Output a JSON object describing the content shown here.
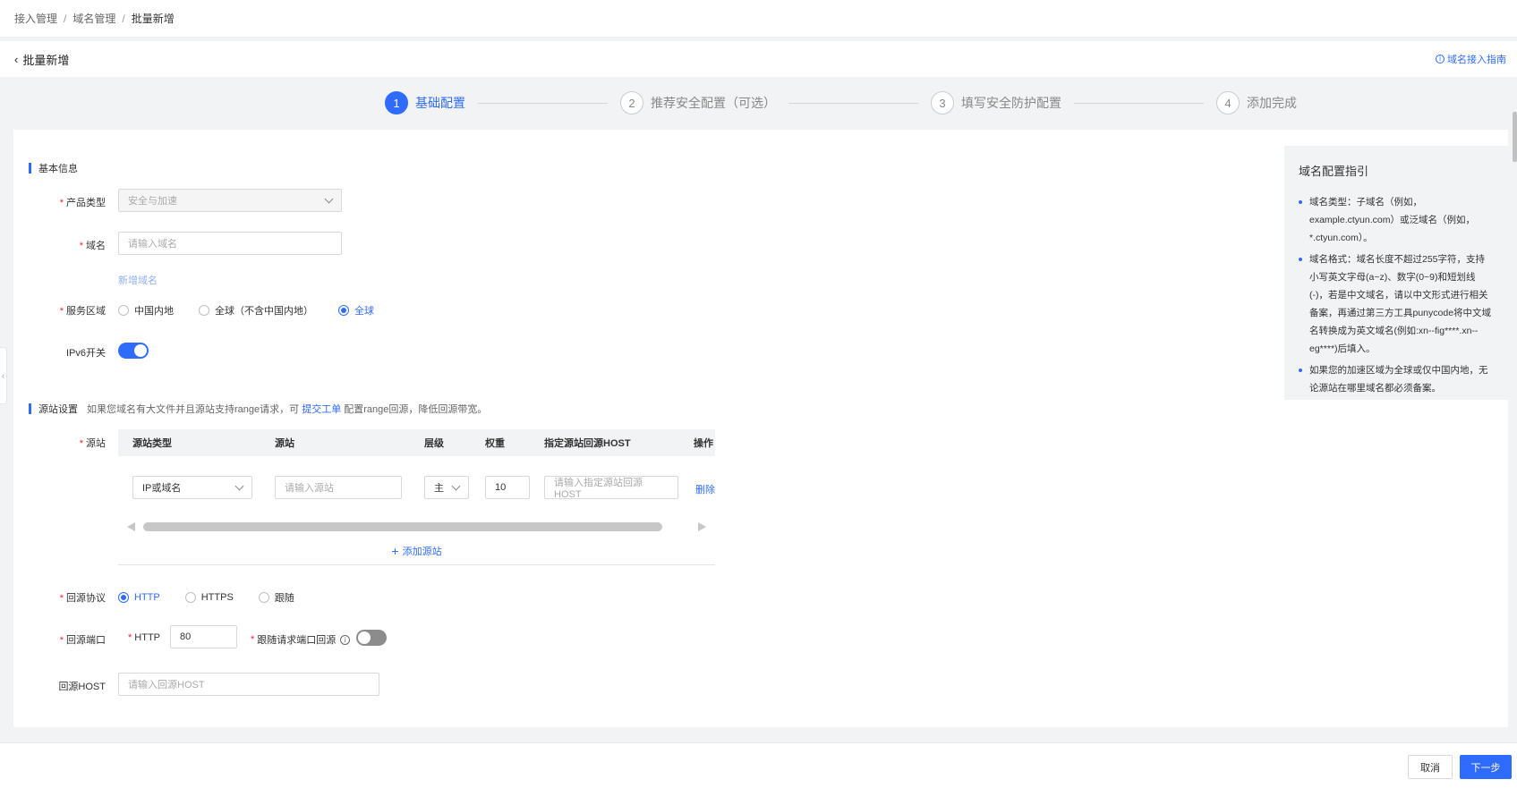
{
  "breadcrumb": {
    "items": [
      "接入管理",
      "域名管理",
      "批量新增"
    ],
    "sep": "/"
  },
  "header": {
    "title": "批量新增",
    "guide_link": "域名接入指南"
  },
  "steps": [
    {
      "num": "1",
      "label": "基础配置"
    },
    {
      "num": "2",
      "label": "推荐安全配置（可选）"
    },
    {
      "num": "3",
      "label": "填写安全防护配置"
    },
    {
      "num": "4",
      "label": "添加完成"
    }
  ],
  "basic": {
    "section_title": "基本信息",
    "product_type": {
      "label": "产品类型",
      "value": "安全与加速"
    },
    "domain": {
      "label": "域名",
      "placeholder": "请输入域名"
    },
    "add_domain": "新增域名",
    "region": {
      "label": "服务区域",
      "options": [
        "中国内地",
        "全球（不含中国内地）",
        "全球"
      ],
      "selected": "全球"
    },
    "ipv6": {
      "label": "IPv6开关",
      "on": true
    }
  },
  "origin": {
    "section_title": "源站设置",
    "hint_prefix": "如果您域名有大文件并且源站支持range请求，可",
    "hint_link": "提交工单",
    "hint_suffix": "配置range回源，降低回源带宽。",
    "label": "源站",
    "table": {
      "columns": [
        "源站类型",
        "源站",
        "层级",
        "权重",
        "指定源站回源HOST",
        "操作"
      ],
      "row": {
        "type": "IP或域名",
        "origin_placeholder": "请输入源站",
        "level": "主",
        "weight": "10",
        "host_placeholder": "请输入指定源站回源HOST",
        "action": "删除"
      }
    },
    "add_origin": "添加源站",
    "protocol": {
      "label": "回源协议",
      "options": [
        "HTTP",
        "HTTPS",
        "跟随"
      ],
      "selected": "HTTP"
    },
    "port": {
      "label": "回源端口",
      "http_label": "HTTP",
      "http_value": "80",
      "follow_label": "跟随请求端口回源",
      "follow_on": false
    },
    "host": {
      "label": "回源HOST",
      "placeholder": "请输入回源HOST"
    }
  },
  "guide": {
    "title": "域名配置指引",
    "items": [
      "域名类型：子域名（例如，example.ctyun.com）或泛域名（例如，*.ctyun.com）。",
      "域名格式：域名长度不超过255字符，支持小写英文字母(a~z)、数字(0~9)和短划线(-)，若是中文域名，请以中文形式进行相关备案，再通过第三方工具punycode将中文域名转换成为英文域名(例如:xn--fig****.xn--eg****)后填入。",
      "如果您的加速区域为全球或仅中国内地，无论源站在哪里域名都必须备案。"
    ]
  },
  "footer": {
    "cancel": "取消",
    "next": "下一步"
  },
  "colors": {
    "primary": "#2f6bff",
    "required": "#f5222d"
  }
}
